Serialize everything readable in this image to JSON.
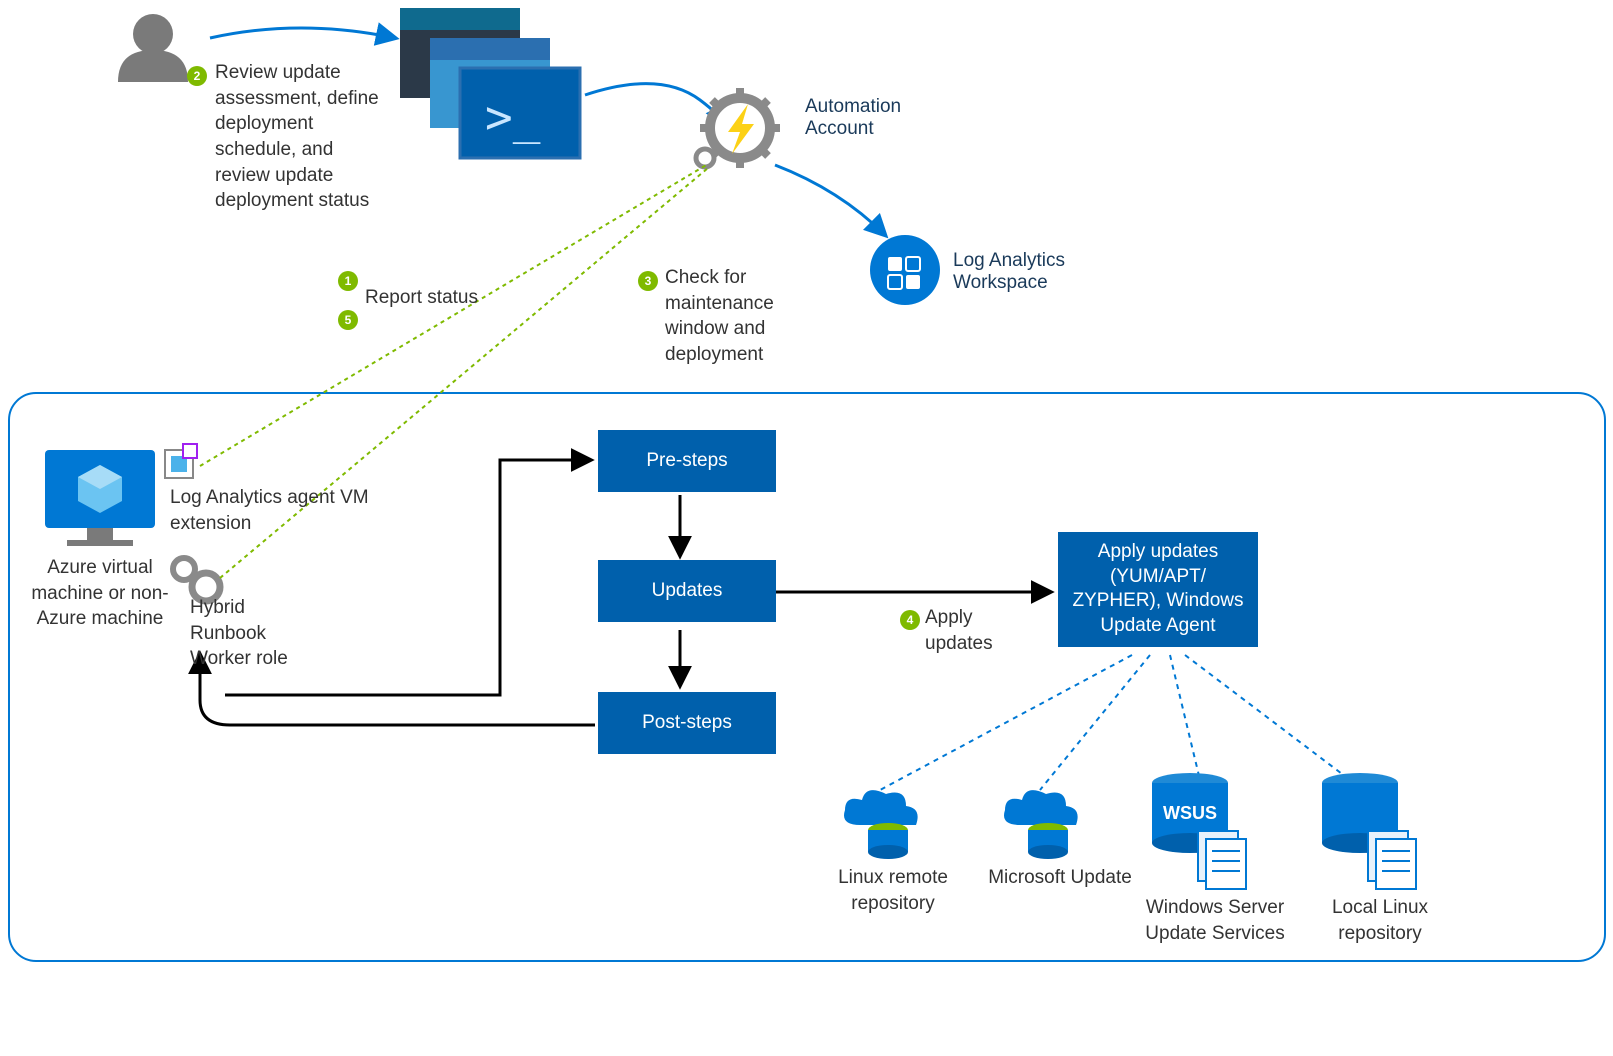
{
  "steps": {
    "s1": {
      "num": "1",
      "text": "Report status"
    },
    "s2": {
      "num": "2",
      "text": "Review update assessment, define deployment schedule, and review update deployment status"
    },
    "s3": {
      "num": "3",
      "text": "Check for maintenance window and deployment"
    },
    "s4": {
      "num": "4",
      "text": "Apply updates"
    },
    "s5": {
      "num": "5"
    }
  },
  "icons": {
    "automation": "Automation Account",
    "log_analytics": "Log Analytics Workspace",
    "vm": "Azure virtual machine or non-Azure machine",
    "la_agent": "Log Analytics agent VM extension",
    "hybrid": "Hybrid Runbook Worker role"
  },
  "flow": {
    "pre": "Pre-steps",
    "updates": "Updates",
    "post": "Post-steps",
    "apply": "Apply updates (YUM/APT/ ZYPHER), Windows Update Agent"
  },
  "targets": {
    "linux_remote": "Linux remote repository",
    "ms_update": "Microsoft Update",
    "wsus_box": "WSUS",
    "wsus": "Windows Server Update Services",
    "local_linux": "Local Linux repository"
  }
}
